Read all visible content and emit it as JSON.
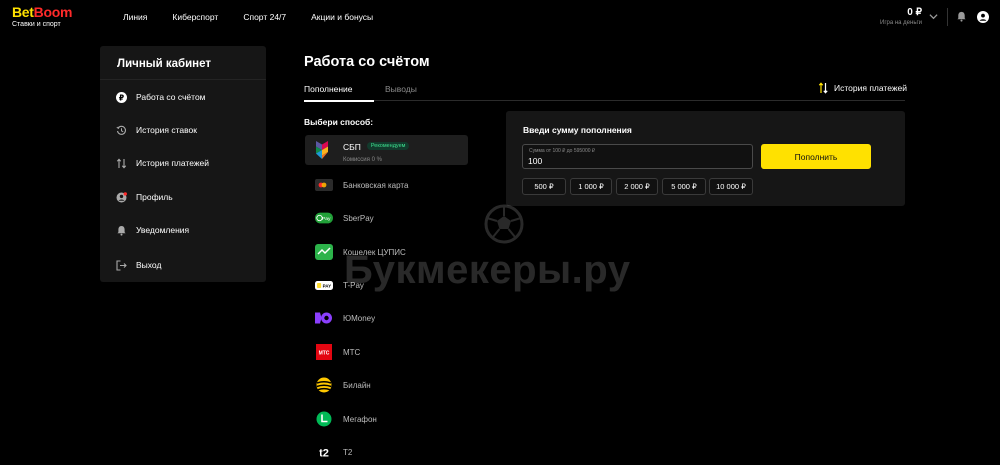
{
  "header": {
    "logo_bet": "Bet",
    "logo_boom": "Boom",
    "logo_tagline": "Ставки и спорт",
    "nav": [
      "Линия",
      "Киберспорт",
      "Спорт 24/7",
      "Акции и бонусы"
    ],
    "balance": "0 ₽",
    "balance_caption": "Игра на деньги",
    "icons": [
      "chevron-down-icon",
      "bell-icon",
      "user-icon"
    ]
  },
  "sidebar": {
    "title": "Личный кабинет",
    "items": [
      {
        "label": "Работа со счётом",
        "icon": "ruble-coin-icon",
        "active": true
      },
      {
        "label": "История ставок",
        "icon": "history-icon",
        "active": false
      },
      {
        "label": "История платежей",
        "icon": "transfer-arrows-icon",
        "active": false
      },
      {
        "label": "Профиль",
        "icon": "profile-icon",
        "active": false
      },
      {
        "label": "Уведомления",
        "icon": "bell-icon",
        "active": false
      },
      {
        "label": "Выход",
        "icon": "logout-icon",
        "active": false
      }
    ]
  },
  "main": {
    "title": "Работа со счётом",
    "tabs": [
      {
        "label": "Пополнение",
        "active": true
      },
      {
        "label": "Выводы",
        "active": false
      }
    ],
    "history_link": "История платежей",
    "choose_label": "Выбери способ:",
    "methods": [
      {
        "name": "СБП",
        "badge": "Рекомендуем",
        "commission": "Комиссия 0 %",
        "icon": "sbp-icon",
        "selected": true
      },
      {
        "name": "Банковская карта",
        "icon": "bank-card-icon",
        "selected": false
      },
      {
        "name": "SberPay",
        "icon": "sberpay-icon",
        "selected": false
      },
      {
        "name": "Кошелек ЦУПИС",
        "icon": "wallet-icon",
        "selected": false
      },
      {
        "name": "T-Pay",
        "icon": "tpay-icon",
        "selected": false
      },
      {
        "name": "ЮMoney",
        "icon": "yoomoney-icon",
        "selected": false
      },
      {
        "name": "МТС",
        "icon": "mts-icon",
        "selected": false
      },
      {
        "name": "Билайн",
        "icon": "beeline-icon",
        "selected": false
      },
      {
        "name": "Мегафон",
        "icon": "megafon-icon",
        "selected": false
      },
      {
        "name": "T2",
        "icon": "t2-icon",
        "selected": false
      }
    ]
  },
  "deposit": {
    "title": "Введи сумму пополнения",
    "hint": "Сумма от 100 ₽ до 595000 ₽",
    "value": "100",
    "button": "Пополнить",
    "quick_amounts": [
      "500 ₽",
      "1 000 ₽",
      "2 000 ₽",
      "5 000 ₽",
      "10 000 ₽"
    ]
  },
  "watermark": "Букмекеры.ру",
  "colors": {
    "accent_yellow": "#ffe100",
    "brand_red": "#ff2a2a",
    "panel_bg": "#161616",
    "badge_green": "#3ee08f"
  }
}
